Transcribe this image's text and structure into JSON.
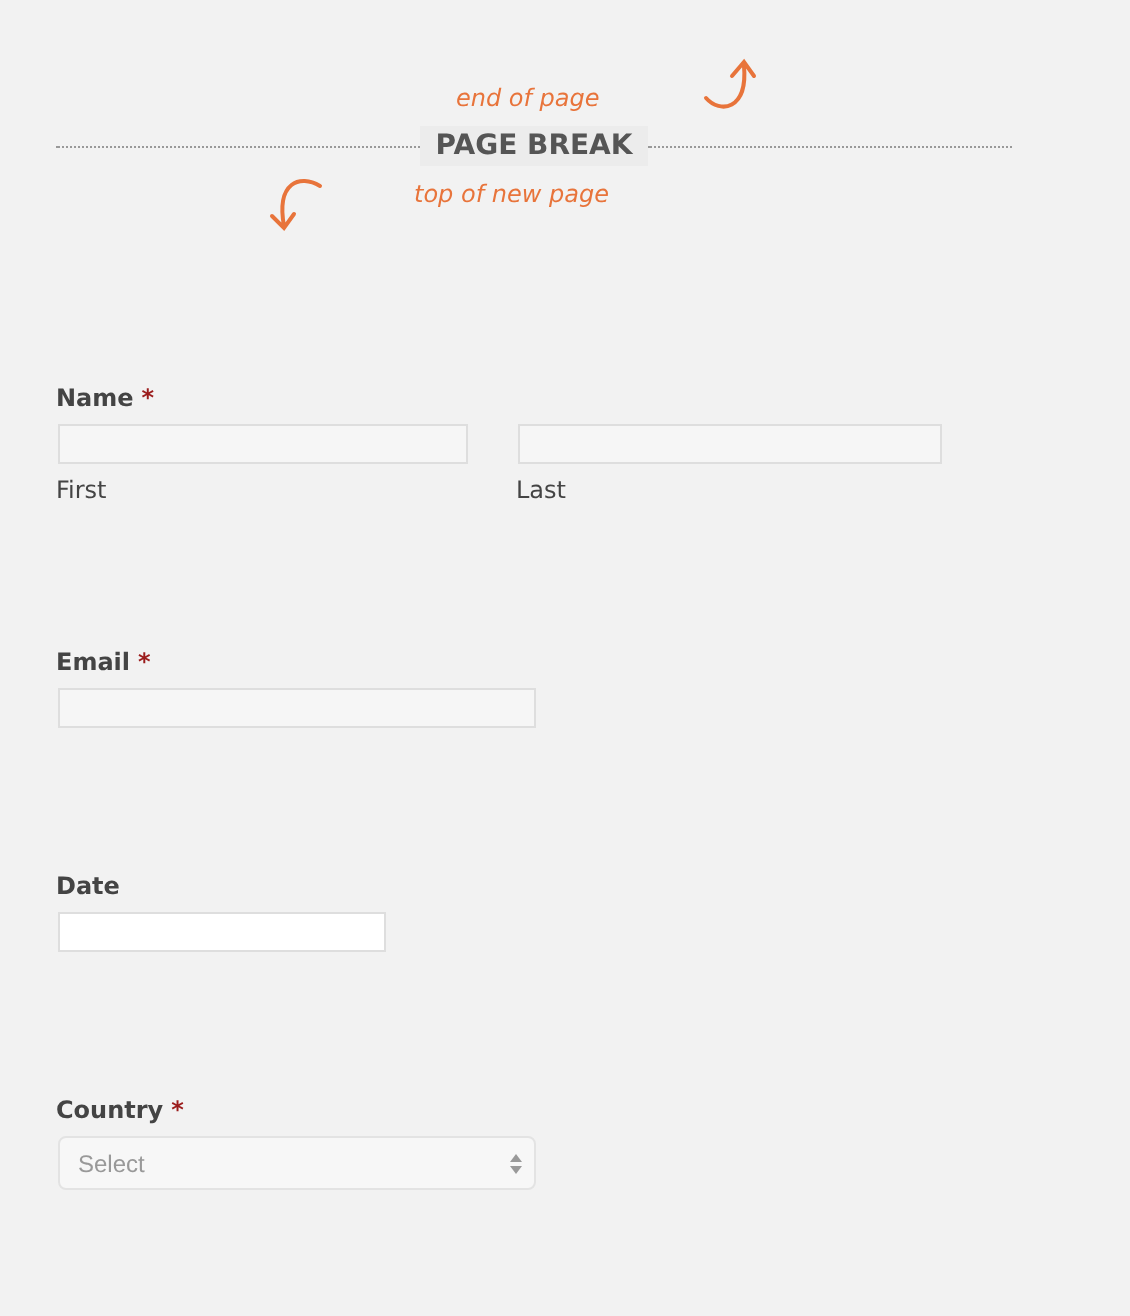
{
  "page_break": {
    "end_note": "end of page",
    "label": "PAGE BREAK",
    "start_note": "top of new page"
  },
  "fields": [
    {
      "kind": "name",
      "label": "Name",
      "required_mark": "*",
      "sublabels": [
        "First",
        "Last"
      ]
    },
    {
      "kind": "email",
      "label": "Email",
      "required_mark": "*"
    },
    {
      "kind": "date",
      "label": "Date"
    },
    {
      "kind": "select",
      "label": "Country",
      "required_mark": "*",
      "placeholder": "Select"
    }
  ]
}
